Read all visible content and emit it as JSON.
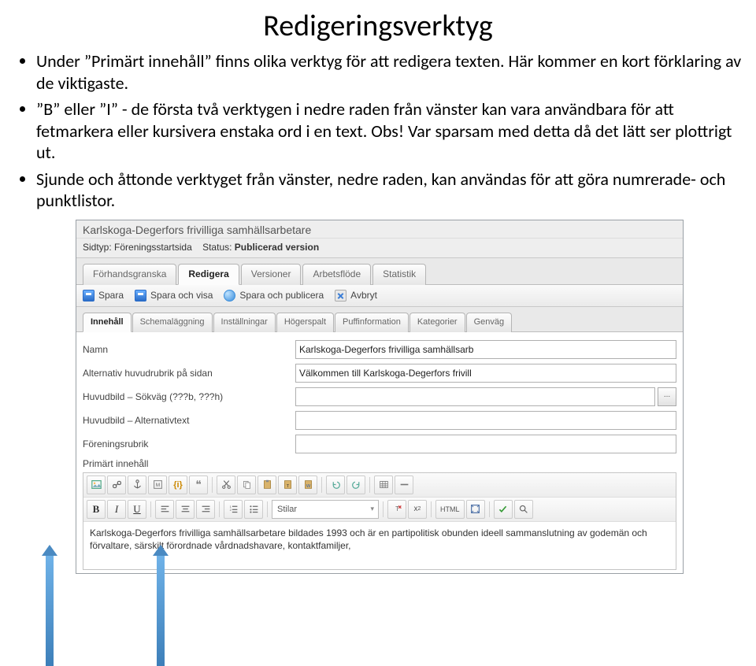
{
  "title": "Redigeringsverktyg",
  "bullets": [
    "Under ”Primärt innehåll” finns olika verktyg för att redigera texten. Här kommer en kort förklaring av de viktigaste.",
    "”B” eller ”I” - de första två verktygen i nedre raden från vänster kan vara användbara för att fetmarkera eller kursivera enstaka ord i en text. Obs! Var sparsam med detta då det lätt ser plottrigt ut.",
    "Sjunde och åttonde verktyget från vänster, nedre raden, kan användas för att göra numrerade- och punktlistor."
  ],
  "editor": {
    "breadcrumb": "Karlskoga-Degerfors frivilliga samhällsarbetare",
    "meta": {
      "sidtyp_label": "Sidtyp:",
      "sidtyp_value": "Föreningsstartsida",
      "status_label": "Status:",
      "status_value": "Publicerad version"
    },
    "main_tabs": [
      "Förhandsgranska",
      "Redigera",
      "Versioner",
      "Arbetsflöde",
      "Statistik"
    ],
    "main_tab_active": 1,
    "actions": {
      "save": "Spara",
      "save_show": "Spara och visa",
      "save_publish": "Spara och publicera",
      "cancel": "Avbryt"
    },
    "sub_tabs": [
      "Innehåll",
      "Schemaläggning",
      "Inställningar",
      "Högerspalt",
      "Puffinformation",
      "Kategorier",
      "Genväg"
    ],
    "sub_tab_active": 0,
    "fields": {
      "name": {
        "label": "Namn",
        "value": "Karlskoga-Degerfors frivilliga samhällsarb"
      },
      "alt_heading": {
        "label": "Alternativ huvudrubrik på sidan",
        "value": "Välkommen till Karlskoga-Degerfors frivill"
      },
      "image_path": {
        "label": "Huvudbild – Sökväg (???b, ???h)",
        "value": ""
      },
      "image_alt": {
        "label": "Huvudbild – Alternativtext",
        "value": ""
      },
      "assoc_heading": {
        "label": "Föreningsrubrik",
        "value": ""
      },
      "primary_label": "Primärt innehåll"
    },
    "rte": {
      "styles_label": "Stilar",
      "html_label": "HTML",
      "content": "Karlskoga-Degerfors frivilliga samhällsarbetare bildades 1993 och är en partipolitisk obunden ideell sammanslutning av godemän och förvaltare, särskilt förordnade vårdnadshavare, kontaktfamiljer,"
    },
    "browse_btn": "..."
  }
}
